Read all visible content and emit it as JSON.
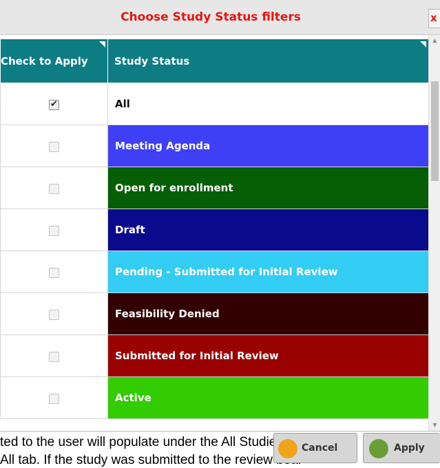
{
  "dialog": {
    "title": "Choose Study Status filters",
    "close_label": "x"
  },
  "table": {
    "headers": {
      "check": "Check to Apply",
      "status": "Study Status"
    },
    "rows": [
      {
        "label": "All",
        "checked": true,
        "bg": "#ffffff",
        "fg": "#111111"
      },
      {
        "label": "Meeting Agenda",
        "checked": false,
        "bg": "#3f3ff5",
        "fg": "#ffffff"
      },
      {
        "label": "Open for enrollment",
        "checked": false,
        "bg": "#065f06",
        "fg": "#ffffff"
      },
      {
        "label": "Draft",
        "checked": false,
        "bg": "#0a0a8c",
        "fg": "#ffffff"
      },
      {
        "label": "Pending - Submitted for Initial Review",
        "checked": false,
        "bg": "#33ccf2",
        "fg": "#ffffff"
      },
      {
        "label": "Feasibility Denied",
        "checked": false,
        "bg": "#330000",
        "fg": "#ffffff"
      },
      {
        "label": "Submitted for Initial Review",
        "checked": false,
        "bg": "#990000",
        "fg": "#ffffff"
      },
      {
        "label": "Active",
        "checked": false,
        "bg": "#33cc00",
        "fg": "#ffffff"
      }
    ]
  },
  "footer": {
    "cancel_label": "Cancel",
    "apply_label": "Apply"
  },
  "background_text": {
    "line1": "ted to the user will populate under the All Studies sect",
    "line2": "All tab. If the study was submitted to the review boar"
  },
  "colors": {
    "header_teal": "#0e7c83",
    "title_red": "#e8140f"
  }
}
